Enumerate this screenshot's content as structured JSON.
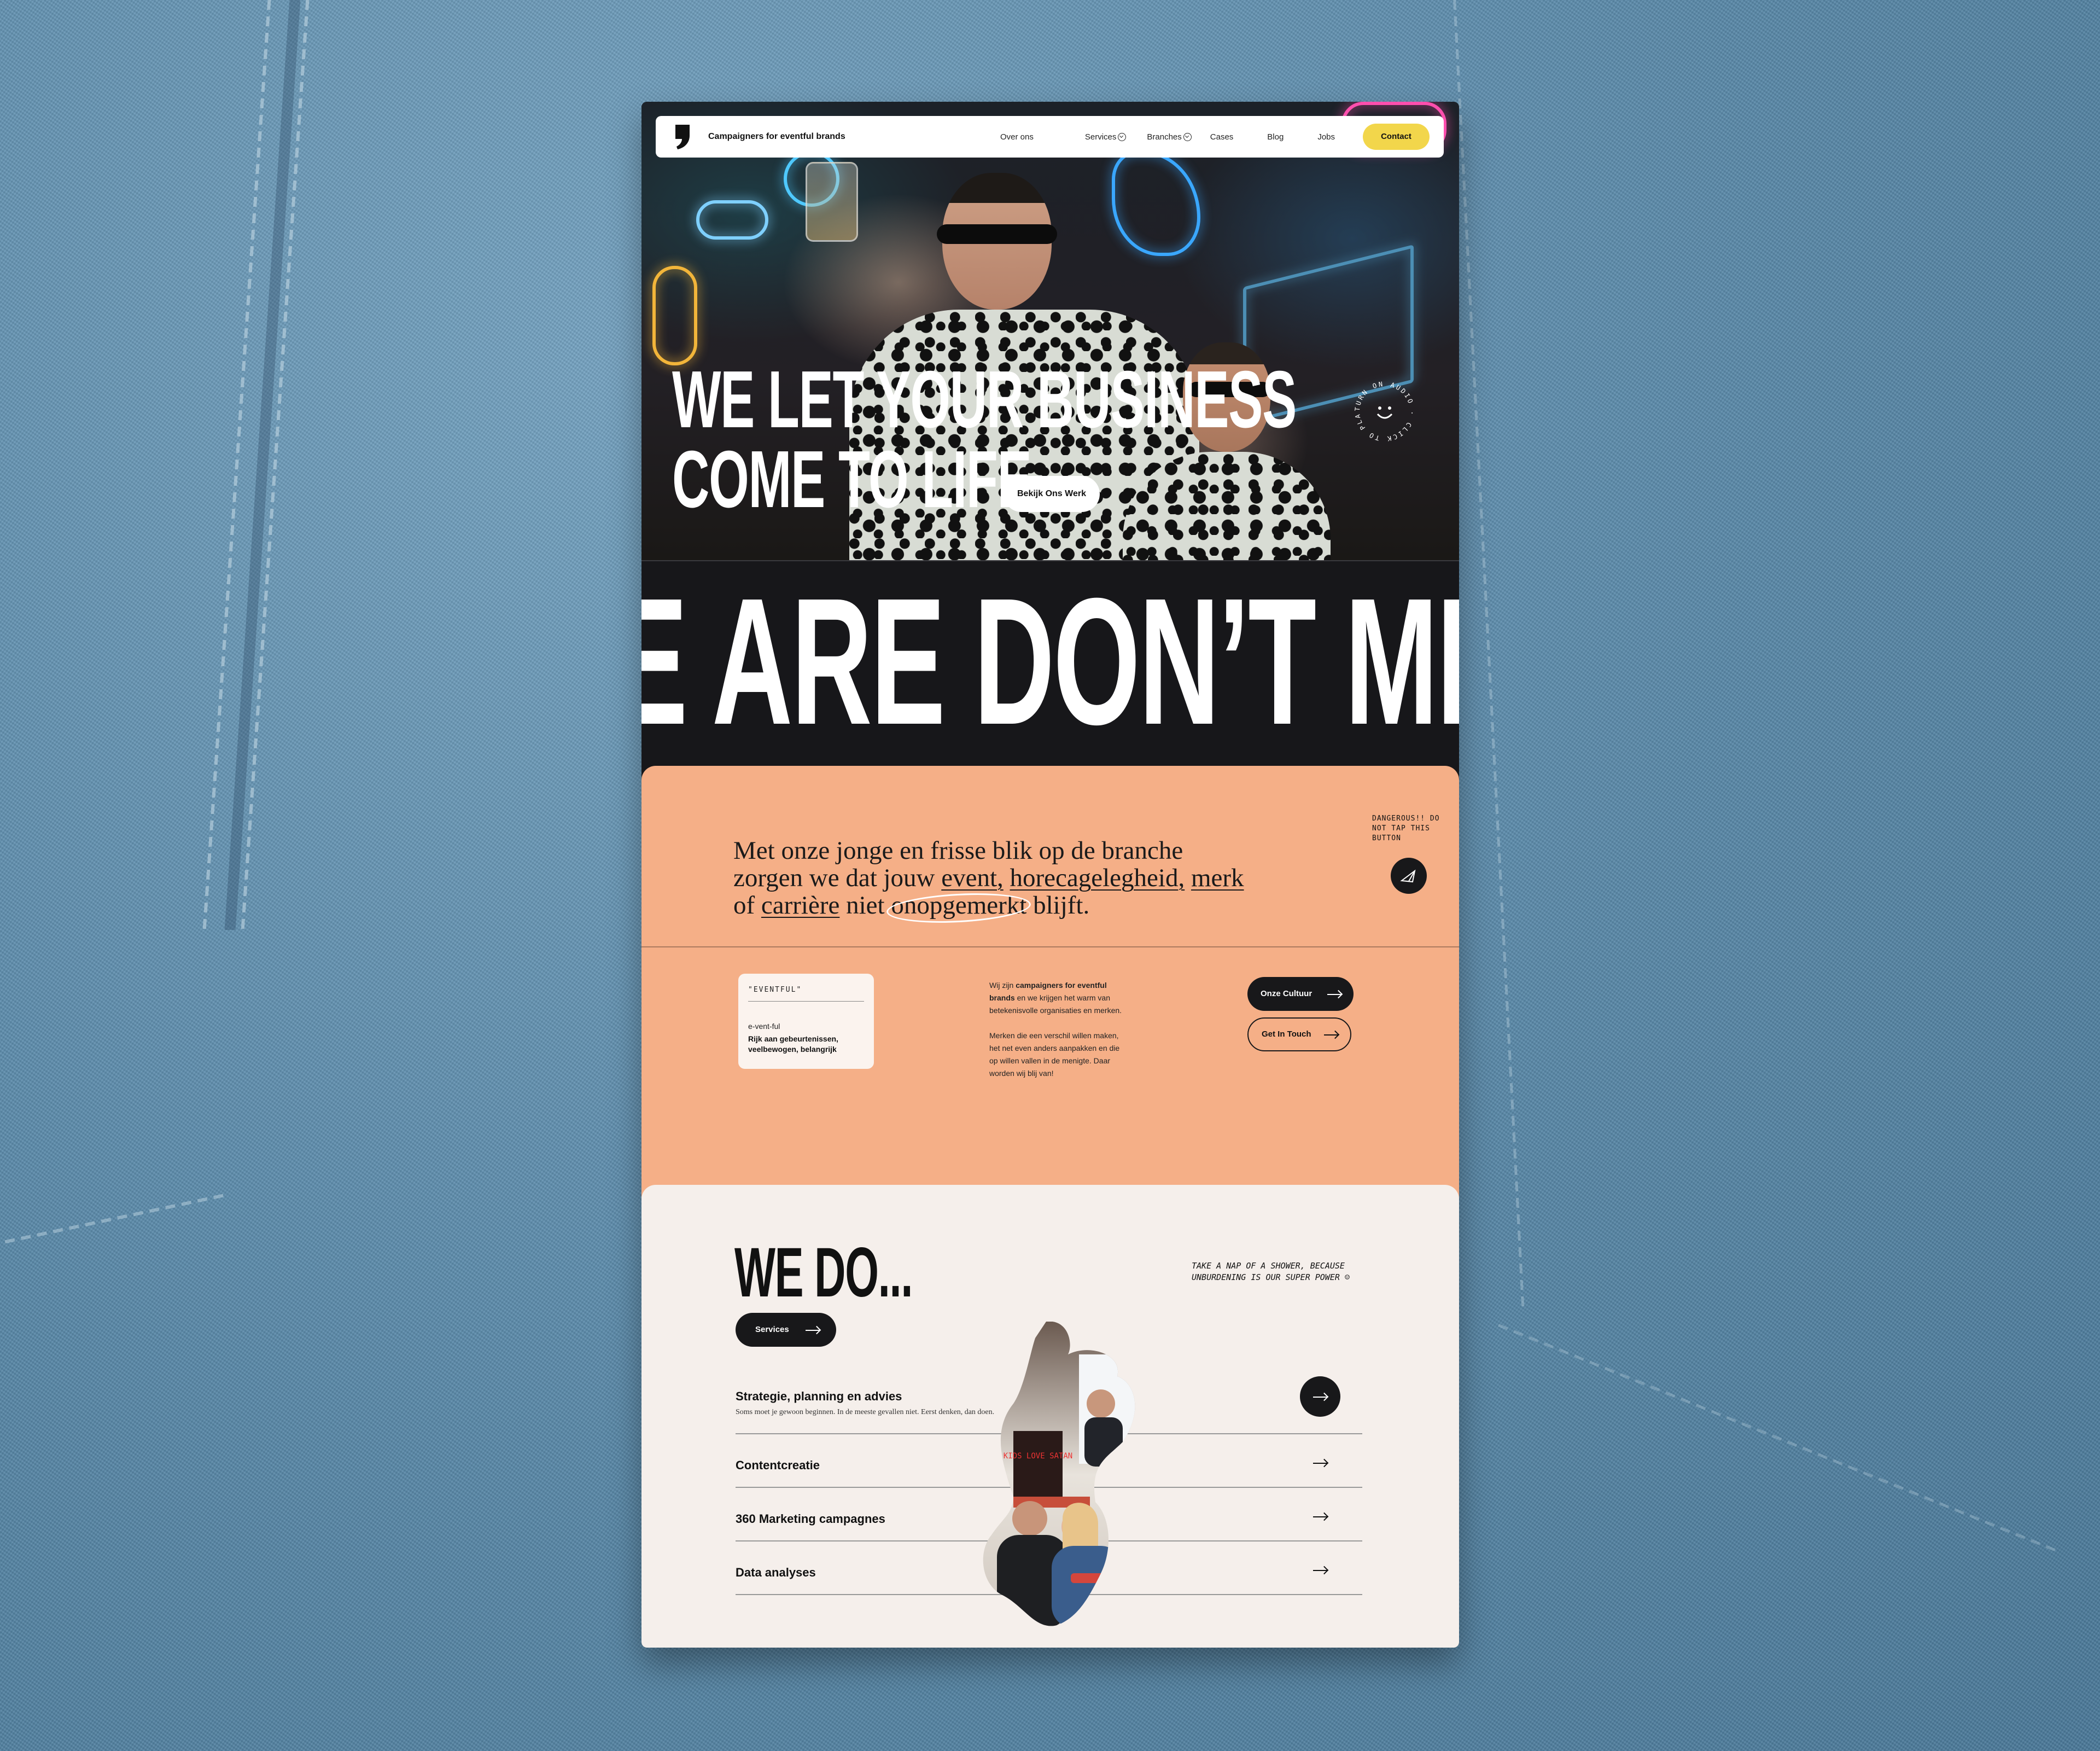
{
  "nav": {
    "brand": "Campaigners for eventful brands",
    "links": [
      "Over ons",
      "Services",
      "Branches",
      "Cases",
      "Blog",
      "Jobs"
    ],
    "contact": "Contact"
  },
  "hero": {
    "title_line1": "WE LET YOUR BUSINESS",
    "title_line2": "COME TO LIFE",
    "cta": "Bekijk Ons Werk",
    "badge_text": "TURN ON AUDIO · CLICK TO PLAY"
  },
  "marquee": {
    "text": "E ARE DON’T MIND"
  },
  "intro": {
    "pre": "Met onze jonge en frisse blik op de branche zorgen we dat jouw ",
    "w1": "event,",
    "w2": "horecagelegheid,",
    "w3": "merk",
    "mid": " of ",
    "w4": "carrière",
    "niet": " niet ",
    "w5": "onopgemerkt",
    "end": " blijft.",
    "danger_note": "DANGEROUS!! DO NOT TAP THIS BUTTON"
  },
  "definition": {
    "quote": "\"EVENTFUL\"",
    "word": "e-vent-ful",
    "meaning": "Rijk aan gebeurtenissen, veelbewogen, belangrijk"
  },
  "about": {
    "p1_pre": "Wij zijn ",
    "p1_bold": "campaigners for eventful brands",
    "p1_post": " en we krijgen het warm van betekenisvolle organisaties en merken.",
    "p2": "Merken die een verschil willen maken, het net even anders aanpakken en die op willen vallen in de menigte. Daar worden wij blij van!",
    "btn1": "Onze Cultuur",
    "btn2": "Get In Touch"
  },
  "wedo": {
    "title": "WE DO...",
    "button": "Services",
    "note": "TAKE A NAP OF A SHOWER, BECAUSE UNBURDENING IS OUR SUPER POWER ☺",
    "services": [
      {
        "name": "Strategie, planning en advies",
        "sub": "Soms moet je gewoon beginnen. In de meeste gevallen niet. Eerst denken, dan doen."
      },
      {
        "name": "Contentcreatie"
      },
      {
        "name": "360 Marketing campagnes"
      },
      {
        "name": "Data analyses"
      }
    ],
    "photo_sign": "KIDS LOVE SATAN"
  }
}
